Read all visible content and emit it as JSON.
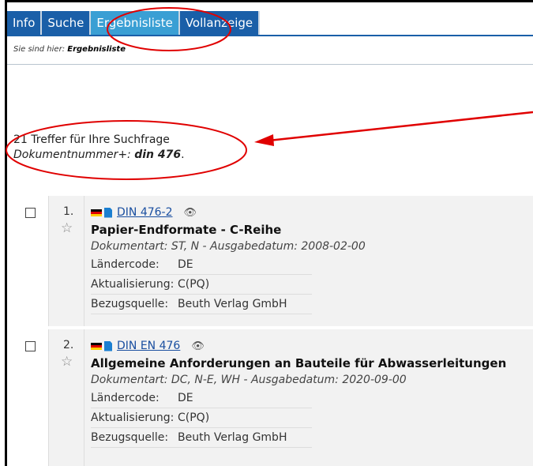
{
  "tabs": [
    {
      "label": "Info"
    },
    {
      "label": "Suche"
    },
    {
      "label": "Ergebnisliste"
    },
    {
      "label": "Vollanzeige"
    }
  ],
  "breadcrumb": {
    "prefix": "Sie sind hier:",
    "current": "Ergebnisliste"
  },
  "hits": {
    "text": "21 Treffer für Ihre Suchfrage",
    "query_label": "Dokumentnummer+:",
    "query_value": "din 476",
    "end": "."
  },
  "results": [
    {
      "number": "1.",
      "link": "DIN 476-2",
      "title": "Papier-Endformate - C-Reihe",
      "meta": "Dokumentart: ST, N - Ausgabedatum: 2008-02-00",
      "fields": [
        {
          "key": "Ländercode:",
          "value": "DE"
        },
        {
          "key": "Aktualisierung:",
          "value": "C(PQ)"
        },
        {
          "key": "Bezugsquelle:",
          "value": "Beuth Verlag GmbH"
        }
      ]
    },
    {
      "number": "2.",
      "link": "DIN EN 476",
      "title": "Allgemeine Anforderungen an Bauteile für Abwasserleitungen",
      "meta": "Dokumentart: DC, N-E, WH - Ausgabedatum: 2020-09-00",
      "fields": [
        {
          "key": "Ländercode:",
          "value": "DE"
        },
        {
          "key": "Aktualisierung:",
          "value": "C(PQ)"
        },
        {
          "key": "Bezugsquelle:",
          "value": "Beuth Verlag GmbH"
        }
      ]
    }
  ],
  "colors": {
    "tab": "#1a5fa8",
    "tab_active": "#3a9fd4",
    "annotation": "#e00000"
  }
}
